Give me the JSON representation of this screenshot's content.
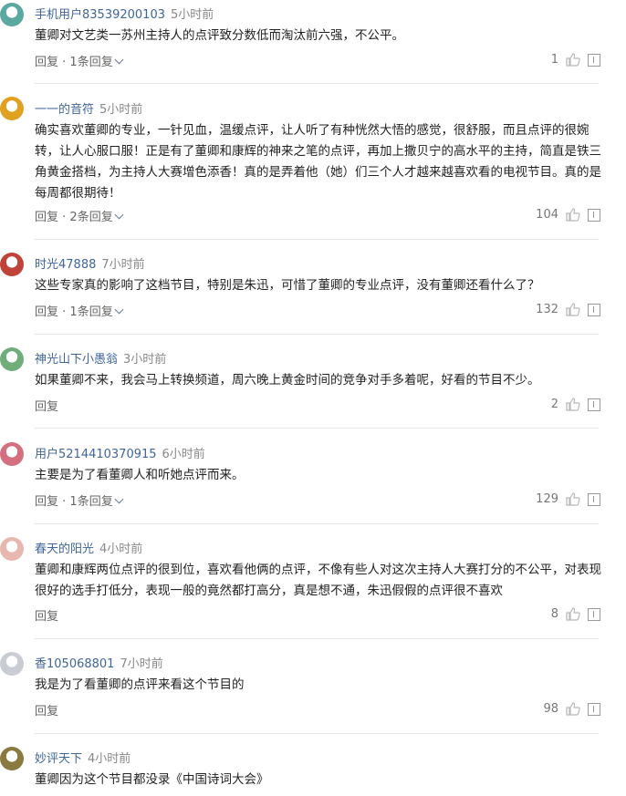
{
  "labels": {
    "reply": "回复",
    "sep": " · "
  },
  "comments": [
    {
      "user": "手机用户83539200103",
      "time": "5小时前",
      "avatar_color": "#5aa9a0",
      "text": "董卿对文艺类一苏州主持人的点评致分数低而淘汰前六强，不公平。",
      "replies": "1条回复",
      "likes": "1"
    },
    {
      "user": "一一的音符",
      "time": "5小时前",
      "avatar_color": "#e0a020",
      "text": "确实喜欢董卿的专业，一针见血，温缓点评，让人听了有种恍然大悟的感觉，很舒服，而且点评的很婉转，让人心服口服！正是有了董卿和康辉的神来之笔的点评，再加上撒贝宁的高水平的主持，简直是铁三角黄金搭档，为主持人大赛增色添香！真的是弄着他（她）们三个人才越来越喜欢看的电视节目。真的是每周都很期待！",
      "replies": "2条回复",
      "likes": "104"
    },
    {
      "user": "时光47888",
      "time": "7小时前",
      "avatar_color": "#c0433a",
      "text": "这些专家真的影响了这档节目，特别是朱迅，可惜了董卿的专业点评，没有董卿还看什么了？",
      "replies": "1条回复",
      "likes": "132"
    },
    {
      "user": "神光山下小愚翁",
      "time": "3小时前",
      "avatar_color": "#6fae7a",
      "text": "如果董卿不来，我会马上转换频道，周六晚上黄金时间的竞争对手多着呢，好看的节目不少。",
      "replies": "",
      "likes": "2"
    },
    {
      "user": "用户5214410370915",
      "time": "6小时前",
      "avatar_color": "#d56f7f",
      "text": "主要是为了看董卿人和听她点评而来。",
      "replies": "1条回复",
      "likes": "129"
    },
    {
      "user": "春天的阳光",
      "time": "4小时前",
      "avatar_color": "#e8b7b0",
      "text": "董卿和康辉两位点评的很到位，喜欢看他俩的点评，不像有些人对这次主持人大赛打分的不公平，对表现很好的选手打低分，表现一般的竟然都打高分，真是想不通，朱迅假假的点评很不喜欢",
      "replies": "",
      "likes": "8"
    },
    {
      "user": "香105068801",
      "time": "7小时前",
      "avatar_color": "#c9ccd2",
      "text": "我是为了看董卿的点评来看这个节目的",
      "replies": "",
      "likes": "98"
    },
    {
      "user": "妙评天下",
      "time": "4小时前",
      "avatar_color": "#8a7a40",
      "text": "董卿因为这个节目都没录《中国诗词大会》",
      "replies": "",
      "likes": ""
    }
  ]
}
